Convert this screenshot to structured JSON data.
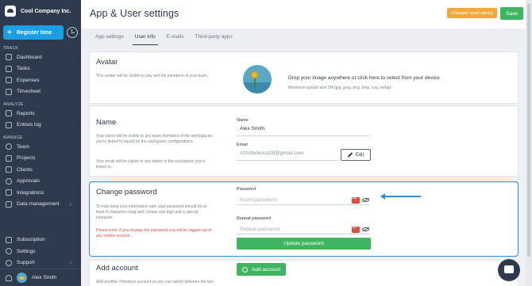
{
  "brand": {
    "name": "Cool Company Inc."
  },
  "register_label": "Register time",
  "sidebar": {
    "sections": [
      {
        "title": "TRACK",
        "items": [
          {
            "label": "Dashboard"
          },
          {
            "label": "Tasks"
          },
          {
            "label": "Expenses"
          },
          {
            "label": "Timesheet"
          }
        ]
      },
      {
        "title": "ANALYZE",
        "items": [
          {
            "label": "Reports"
          },
          {
            "label": "Entries log"
          }
        ]
      },
      {
        "title": "MANAGE",
        "items": [
          {
            "label": "Team"
          },
          {
            "label": "Projects"
          },
          {
            "label": "Clients"
          },
          {
            "label": "Approvals"
          },
          {
            "label": "Integrations"
          },
          {
            "label": "Data management"
          }
        ]
      }
    ],
    "bottom": [
      {
        "label": "Subscription"
      },
      {
        "label": "Settings"
      },
      {
        "label": "Support"
      }
    ],
    "user_name": "Alex Smith"
  },
  "header": {
    "title": "App & User settings",
    "changes_label": "Changes need saving",
    "save_label": "Save"
  },
  "tabs": [
    {
      "label": "App settings"
    },
    {
      "label": "User info",
      "active": true
    },
    {
      "label": "E-mails"
    },
    {
      "label": "Third-party apps"
    }
  ],
  "avatar_section": {
    "title": "Avatar",
    "description": "This avatar will be visible to you and the members of your team.",
    "drop_text": "Drop your image anywhere or click here to select from your device",
    "drop_sub": "Maximum upload size 2M (jpg, jpeg, png, bmp, svg, webp)"
  },
  "name_section": {
    "title": "Name",
    "description1": "Your name will be visible to any team members of the workspaces you're linked to based on the workspace configurations.",
    "description2": "Your email will be visible to any admin in the workspace you're linked to.",
    "name_label": "Name",
    "name_value": "Alex Smith",
    "email_label": "Email",
    "email_value": "rizzofederica28@gmail.com",
    "edit_label": "Edit"
  },
  "password_section": {
    "title": "Change password",
    "description": "To help keep your information safe your password should be at least 8 characters long and contain one digit and a special character",
    "warning": "Please note: If you change the password you will be logged out of any mobile session.",
    "password_label": "Password",
    "password_placeholder": "Insert password",
    "repeat_label": "Repeat password",
    "repeat_placeholder": "Repeat password",
    "update_label": "Update password"
  },
  "account_section": {
    "title": "Add account",
    "description": "Add another Timeneye account so you can switch between the two",
    "button_label": "Add account"
  },
  "colors": {
    "accent": "#1a9fe6",
    "sidebar": "#2e3a4d",
    "green": "#3fb562",
    "orange": "#f2a93b",
    "highlight": "#2a8fd8"
  }
}
